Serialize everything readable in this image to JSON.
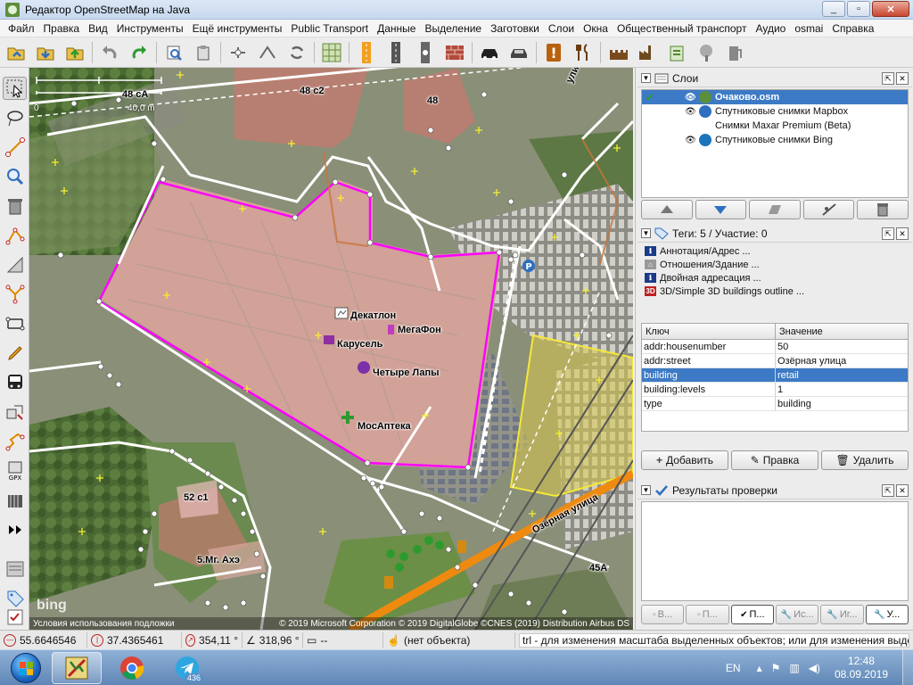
{
  "window": {
    "title": "Редактор OpenStreetMap на Java",
    "min": "_",
    "restore": "▫",
    "close": "✕"
  },
  "menu": [
    "Файл",
    "Правка",
    "Вид",
    "Инструменты",
    "Ещё инструменты",
    "Public Transport",
    "Данные",
    "Выделение",
    "Заготовки",
    "Слои",
    "Окна",
    "Общественный транспорт",
    "Аудио",
    "osmai",
    "Справка"
  ],
  "map": {
    "scale_label": "40,0 m",
    "scale_zero": "0",
    "attribution_left": "Условия использования подложки",
    "attribution_right": "© 2019 Microsoft Corporation © 2019 DigitalGlobe ©CNES (2019) Distribution Airbus DS",
    "bing": "bing",
    "labels": {
      "b48ca": "48 сА",
      "b48c2": "48 с2",
      "b48": "48",
      "dekatlon": "Декатлон",
      "megafon": "МегаФон",
      "karusel": "Карусель",
      "chetyre_lapy": "Четыре Лапы",
      "mosapteka": "МосАптека",
      "b52c1": "52 с1",
      "b5mg": "5.Мг. Ахэ",
      "street_ozernaya": "Озёрная улица",
      "street_ulits": "улиц",
      "b45a": "45А"
    }
  },
  "panels": {
    "layers": {
      "title": "Слои",
      "items": [
        {
          "name": "Очаково.osm",
          "selected": true
        },
        {
          "name": "Спутниковые снимки Mapbox",
          "selected": false
        },
        {
          "name": "Снимки Maxar Premium (Beta)",
          "selected": false
        },
        {
          "name": "Спутниковые снимки Bing",
          "selected": false
        }
      ],
      "buttons": [
        "▲",
        "▼",
        "merge",
        "visibility",
        "delete"
      ]
    },
    "tags": {
      "title": "Теги: 5 / Участие: 0",
      "presets": [
        "Аннотация/Адрес ...",
        "Отношения/Здание ...",
        "Двойная адресация ...",
        "3D/Simple 3D buildings outline ..."
      ],
      "col_key": "Ключ",
      "col_value": "Значение",
      "rows": [
        {
          "key": "addr:housenumber",
          "value": "50",
          "selected": false
        },
        {
          "key": "addr:street",
          "value": "Озёрная улица",
          "selected": false
        },
        {
          "key": "building",
          "value": "retail",
          "selected": true
        },
        {
          "key": "building:levels",
          "value": "1",
          "selected": false
        },
        {
          "key": "type",
          "value": "building",
          "selected": false
        }
      ],
      "add": "Добавить",
      "edit": "Правка",
      "delete": "Удалить"
    },
    "validation": {
      "title": "Результаты проверки",
      "tabs": [
        "В...",
        "П...",
        "П...",
        "Ис...",
        "Иг...",
        "У..."
      ]
    }
  },
  "status": {
    "lat": "55.6646546",
    "lon": "37.4365461",
    "heading": "354,11 °",
    "angle": "318,96 °",
    "distance": "--",
    "object": "(нет объекта)",
    "hint": "trl - для изменения масштаба выделенных объектов; или для изменения выделения"
  },
  "taskbar": {
    "lang": "EN",
    "time": "12:48",
    "date": "08.09.2019",
    "telegram_badge": "436"
  },
  "colors": {
    "accent": "#3d7ac5",
    "selection": "#ff00ff",
    "building": "#e98f86",
    "highlight": "#f2e04a"
  }
}
